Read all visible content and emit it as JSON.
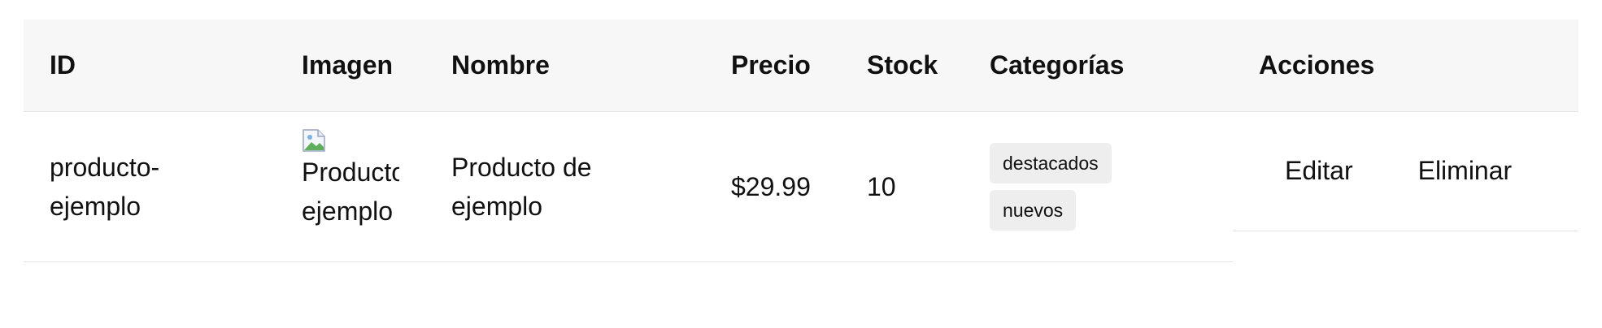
{
  "table": {
    "headers": {
      "id": "ID",
      "image": "Imagen",
      "name": "Nombre",
      "price": "Precio",
      "stock": "Stock",
      "categories": "Categorías",
      "actions": "Acciones"
    },
    "rows": [
      {
        "id": "producto-ejemplo",
        "image_alt": "Producto de ejemplo",
        "name": "Producto de ejemplo",
        "price": "$29.99",
        "stock": "10",
        "categories": [
          "destacados",
          "nuevos"
        ],
        "edit_label": "Editar",
        "delete_label": "Eliminar"
      }
    ]
  },
  "icons": {
    "broken_image": "broken-image-icon"
  }
}
